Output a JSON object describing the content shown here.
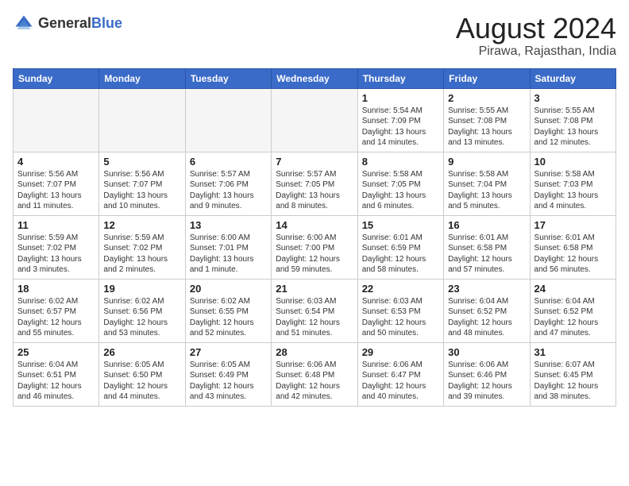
{
  "logo": {
    "text_general": "General",
    "text_blue": "Blue"
  },
  "header": {
    "month_year": "August 2024",
    "location": "Pirawa, Rajasthan, India"
  },
  "weekdays": [
    "Sunday",
    "Monday",
    "Tuesday",
    "Wednesday",
    "Thursday",
    "Friday",
    "Saturday"
  ],
  "weeks": [
    [
      {
        "day": "",
        "info": "",
        "empty": true
      },
      {
        "day": "",
        "info": "",
        "empty": true
      },
      {
        "day": "",
        "info": "",
        "empty": true
      },
      {
        "day": "",
        "info": "",
        "empty": true
      },
      {
        "day": "1",
        "info": "Sunrise: 5:54 AM\nSunset: 7:09 PM\nDaylight: 13 hours\nand 14 minutes."
      },
      {
        "day": "2",
        "info": "Sunrise: 5:55 AM\nSunset: 7:08 PM\nDaylight: 13 hours\nand 13 minutes."
      },
      {
        "day": "3",
        "info": "Sunrise: 5:55 AM\nSunset: 7:08 PM\nDaylight: 13 hours\nand 12 minutes."
      }
    ],
    [
      {
        "day": "4",
        "info": "Sunrise: 5:56 AM\nSunset: 7:07 PM\nDaylight: 13 hours\nand 11 minutes."
      },
      {
        "day": "5",
        "info": "Sunrise: 5:56 AM\nSunset: 7:07 PM\nDaylight: 13 hours\nand 10 minutes."
      },
      {
        "day": "6",
        "info": "Sunrise: 5:57 AM\nSunset: 7:06 PM\nDaylight: 13 hours\nand 9 minutes."
      },
      {
        "day": "7",
        "info": "Sunrise: 5:57 AM\nSunset: 7:05 PM\nDaylight: 13 hours\nand 8 minutes."
      },
      {
        "day": "8",
        "info": "Sunrise: 5:58 AM\nSunset: 7:05 PM\nDaylight: 13 hours\nand 6 minutes."
      },
      {
        "day": "9",
        "info": "Sunrise: 5:58 AM\nSunset: 7:04 PM\nDaylight: 13 hours\nand 5 minutes."
      },
      {
        "day": "10",
        "info": "Sunrise: 5:58 AM\nSunset: 7:03 PM\nDaylight: 13 hours\nand 4 minutes."
      }
    ],
    [
      {
        "day": "11",
        "info": "Sunrise: 5:59 AM\nSunset: 7:02 PM\nDaylight: 13 hours\nand 3 minutes."
      },
      {
        "day": "12",
        "info": "Sunrise: 5:59 AM\nSunset: 7:02 PM\nDaylight: 13 hours\nand 2 minutes."
      },
      {
        "day": "13",
        "info": "Sunrise: 6:00 AM\nSunset: 7:01 PM\nDaylight: 13 hours\nand 1 minute."
      },
      {
        "day": "14",
        "info": "Sunrise: 6:00 AM\nSunset: 7:00 PM\nDaylight: 12 hours\nand 59 minutes."
      },
      {
        "day": "15",
        "info": "Sunrise: 6:01 AM\nSunset: 6:59 PM\nDaylight: 12 hours\nand 58 minutes."
      },
      {
        "day": "16",
        "info": "Sunrise: 6:01 AM\nSunset: 6:58 PM\nDaylight: 12 hours\nand 57 minutes."
      },
      {
        "day": "17",
        "info": "Sunrise: 6:01 AM\nSunset: 6:58 PM\nDaylight: 12 hours\nand 56 minutes."
      }
    ],
    [
      {
        "day": "18",
        "info": "Sunrise: 6:02 AM\nSunset: 6:57 PM\nDaylight: 12 hours\nand 55 minutes."
      },
      {
        "day": "19",
        "info": "Sunrise: 6:02 AM\nSunset: 6:56 PM\nDaylight: 12 hours\nand 53 minutes."
      },
      {
        "day": "20",
        "info": "Sunrise: 6:02 AM\nSunset: 6:55 PM\nDaylight: 12 hours\nand 52 minutes."
      },
      {
        "day": "21",
        "info": "Sunrise: 6:03 AM\nSunset: 6:54 PM\nDaylight: 12 hours\nand 51 minutes."
      },
      {
        "day": "22",
        "info": "Sunrise: 6:03 AM\nSunset: 6:53 PM\nDaylight: 12 hours\nand 50 minutes."
      },
      {
        "day": "23",
        "info": "Sunrise: 6:04 AM\nSunset: 6:52 PM\nDaylight: 12 hours\nand 48 minutes."
      },
      {
        "day": "24",
        "info": "Sunrise: 6:04 AM\nSunset: 6:52 PM\nDaylight: 12 hours\nand 47 minutes."
      }
    ],
    [
      {
        "day": "25",
        "info": "Sunrise: 6:04 AM\nSunset: 6:51 PM\nDaylight: 12 hours\nand 46 minutes."
      },
      {
        "day": "26",
        "info": "Sunrise: 6:05 AM\nSunset: 6:50 PM\nDaylight: 12 hours\nand 44 minutes."
      },
      {
        "day": "27",
        "info": "Sunrise: 6:05 AM\nSunset: 6:49 PM\nDaylight: 12 hours\nand 43 minutes."
      },
      {
        "day": "28",
        "info": "Sunrise: 6:06 AM\nSunset: 6:48 PM\nDaylight: 12 hours\nand 42 minutes."
      },
      {
        "day": "29",
        "info": "Sunrise: 6:06 AM\nSunset: 6:47 PM\nDaylight: 12 hours\nand 40 minutes."
      },
      {
        "day": "30",
        "info": "Sunrise: 6:06 AM\nSunset: 6:46 PM\nDaylight: 12 hours\nand 39 minutes."
      },
      {
        "day": "31",
        "info": "Sunrise: 6:07 AM\nSunset: 6:45 PM\nDaylight: 12 hours\nand 38 minutes."
      }
    ]
  ]
}
